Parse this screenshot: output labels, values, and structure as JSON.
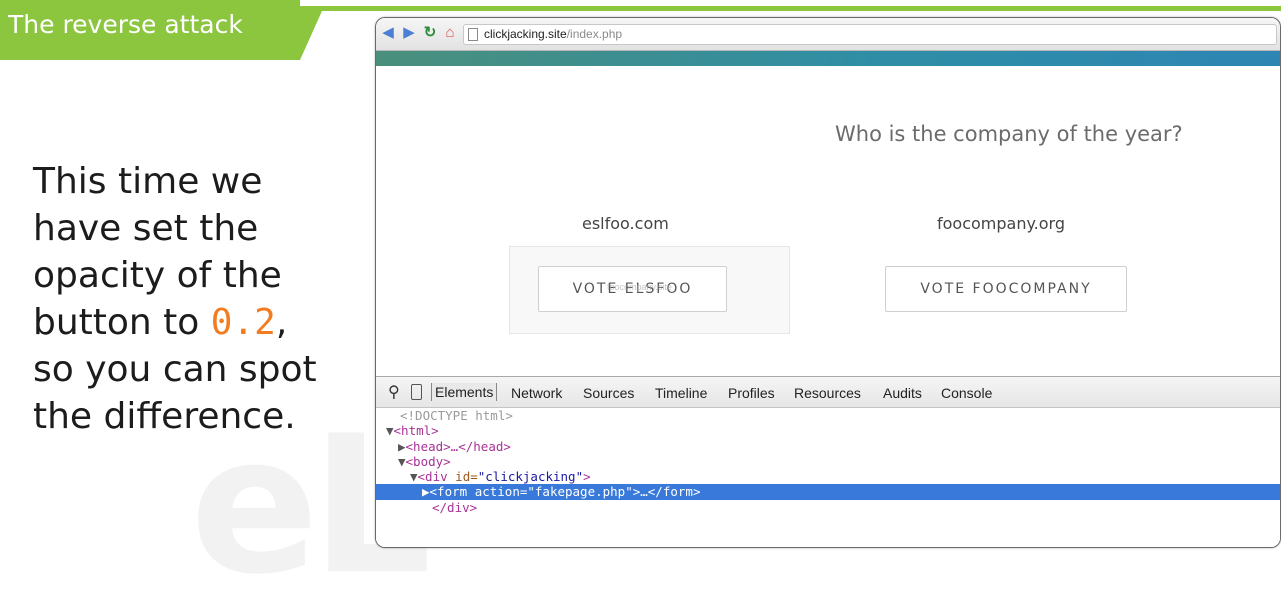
{
  "slide": {
    "title": "The reverse attack",
    "body_text": "This time we have set the opacity of the button to ",
    "body_code": "0.2",
    "body_end": ", so you can spot the difference.",
    "watermark": "eL"
  },
  "browser": {
    "url_domain": "clickjacking.site",
    "url_path": "/index.php",
    "page": {
      "question": "Who is the company of the year?",
      "candidate_left": "eslfoo.com",
      "candidate_right": "foocompany.org",
      "vote_left_label": "VOTE ELSFOO",
      "vote_right_label": "VOTE FOOCOMPANY",
      "ghost_text": "foocompany.site"
    }
  },
  "devtools": {
    "tabs": [
      "Elements",
      "Network",
      "Sources",
      "Timeline",
      "Profiles",
      "Resources",
      "Audits",
      "Console"
    ],
    "dom": {
      "doctype": "<!DOCTYPE html>",
      "html_open": "<html>",
      "head": "<head>…</head>",
      "body_open": "<body>",
      "div_tag": "<div ",
      "div_attr": "id=",
      "div_val": "\"clickjacking\"",
      "div_close": ">",
      "form_tag": "<form ",
      "form_attr": "action=",
      "form_val": "\"fakepage.php\"",
      "form_close": ">…</form>",
      "div_end": "</div>"
    }
  }
}
